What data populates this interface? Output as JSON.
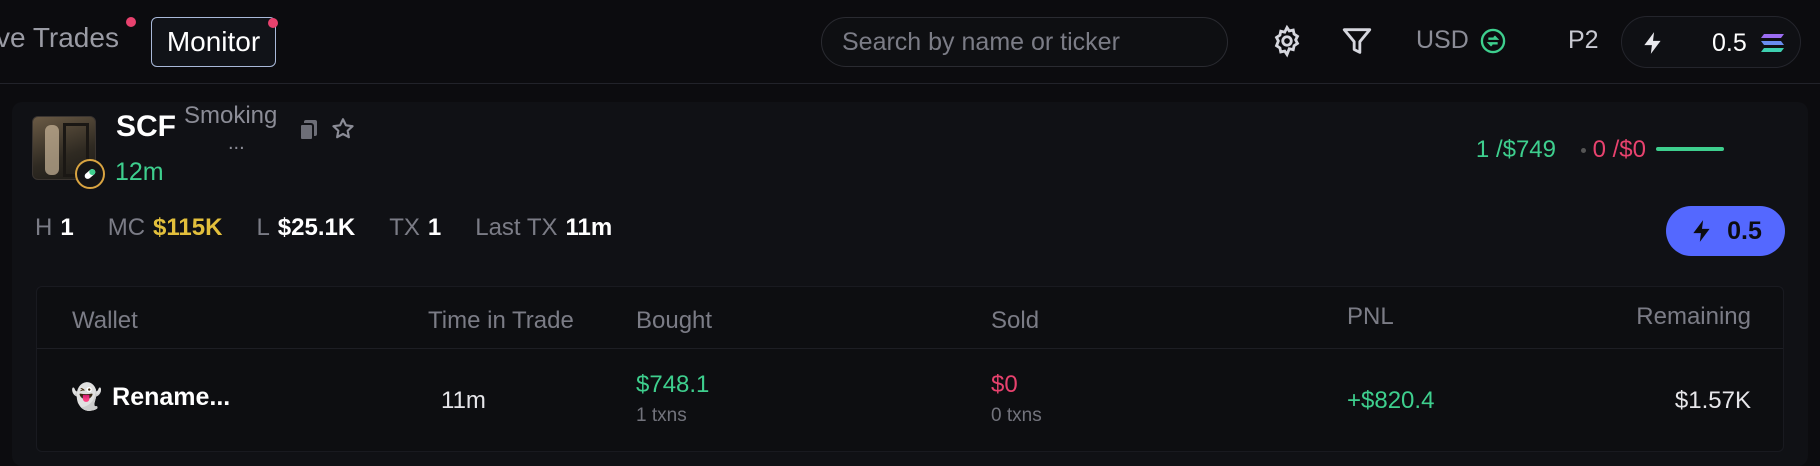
{
  "header": {
    "prev_tab_label": "ve Trades",
    "active_tab_label": "Monitor",
    "search_placeholder": "Search by name or ticker",
    "currency_label": "USD",
    "preset_label": "P2",
    "quick_buy_amount": "0.5"
  },
  "token": {
    "ticker": "SCF",
    "name": "Smoking",
    "name_overflow": "...",
    "age": "12m",
    "buys": "1 /$749",
    "sells": "0 /$0",
    "stats": [
      {
        "key": "H",
        "value": "1"
      },
      {
        "key": "MC",
        "value": "$115K"
      },
      {
        "key": "L",
        "value": "$25.1K"
      },
      {
        "key": "TX",
        "value": "1"
      },
      {
        "key": "Last TX",
        "value": "11m"
      }
    ],
    "buy_button_amount": "0.5"
  },
  "table": {
    "headers": {
      "wallet": "Wallet",
      "time_in_trade": "Time in Trade",
      "bought": "Bought",
      "sold": "Sold",
      "pnl": "PNL",
      "remaining": "Remaining"
    },
    "rows": [
      {
        "wallet_emoji": "👻",
        "wallet": "Rename...",
        "time_in_trade": "11m",
        "bought": "$748.1",
        "bought_txns": "1 txns",
        "sold": "$0",
        "sold_txns": "0 txns",
        "pnl": "+$820.4",
        "remaining": "$1.57K"
      }
    ]
  },
  "colors": {
    "positive": "#3ecf8e",
    "negative": "#e8426e",
    "market_cap": "#e2bf3c",
    "accent": "#5468ff"
  }
}
